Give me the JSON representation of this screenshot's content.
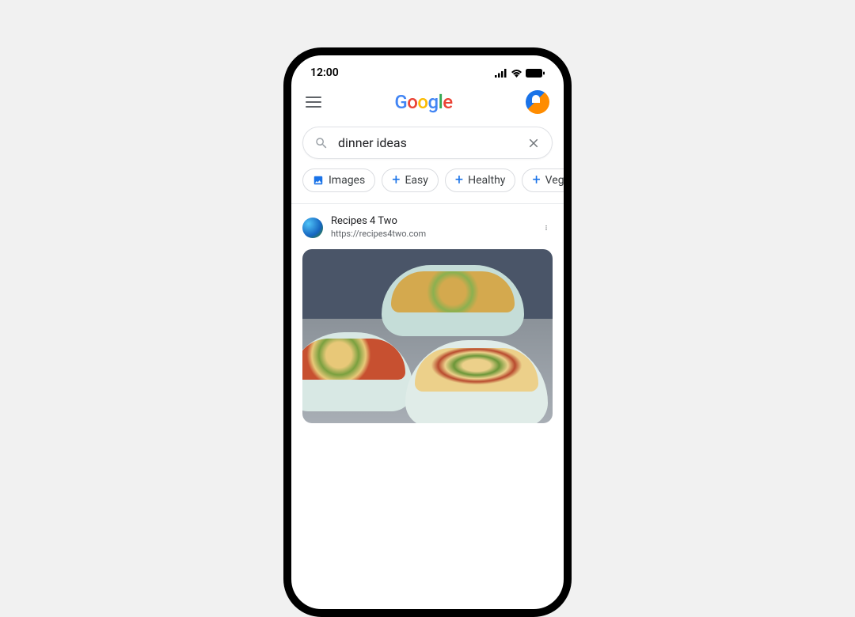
{
  "status": {
    "time": "12:00"
  },
  "logo": {
    "g1": "G",
    "o1": "o",
    "o2": "o",
    "g2": "g",
    "l": "l",
    "e": "e"
  },
  "search": {
    "query": "dinner ideas"
  },
  "chips": [
    {
      "label": "Images",
      "style": "image"
    },
    {
      "label": "Easy",
      "style": "plus"
    },
    {
      "label": "Healthy",
      "style": "plus"
    },
    {
      "label": "Veget",
      "style": "plus"
    }
  ],
  "result": {
    "site_name": "Recipes 4 Two",
    "site_url": "https://recipes4two.com"
  }
}
